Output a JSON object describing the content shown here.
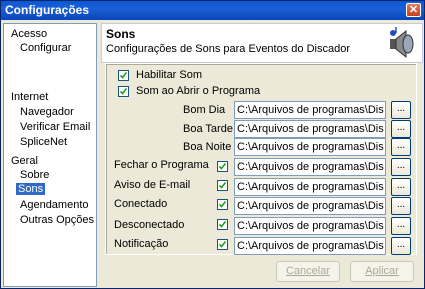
{
  "window": {
    "title": "Configurações",
    "close_label": "✕"
  },
  "sidebar": {
    "groups": [
      {
        "label": "Acesso",
        "items": [
          "Configurar"
        ]
      },
      {
        "label": "Internet",
        "items": [
          "Navegador",
          "Verificar Email",
          "SpliceNet"
        ]
      },
      {
        "label": "Geral",
        "items": [
          "Sobre",
          "Sons",
          "Agendamento",
          "Outras Opções"
        ]
      }
    ],
    "selected": "Sons"
  },
  "header": {
    "title": "Sons",
    "subtitle": "Configurações de Sons para Eventos do Discador",
    "icon": "speaker-music-icon"
  },
  "options": {
    "enable_sound": {
      "label": "Habilitar Som",
      "checked": true
    },
    "on_open": {
      "label": "Som ao Abrir o Programa",
      "checked": true
    }
  },
  "rows": [
    {
      "label": "Bom Dia",
      "path": "C:\\Arquivos de programas\\Dis",
      "browse": "..."
    },
    {
      "label": "Boa Tarde",
      "path": "C:\\Arquivos de programas\\Dis",
      "browse": "..."
    },
    {
      "label": "Boa Noite",
      "path": "C:\\Arquivos de programas\\Dis",
      "browse": "..."
    },
    {
      "label": "Fechar o Programa",
      "path": "C:\\Arquivos de programas\\Dis",
      "browse": "...",
      "checked": true
    },
    {
      "label": "Aviso de E-mail",
      "path": "C:\\Arquivos de programas\\Dis",
      "browse": "...",
      "checked": true
    },
    {
      "label": "Conectado",
      "path": "C:\\Arquivos de programas\\Dis",
      "browse": "...",
      "checked": true
    },
    {
      "label": "Desconectado",
      "path": "C:\\Arquivos de programas\\Dis",
      "browse": "...",
      "checked": true
    },
    {
      "label": "Notificação",
      "path": "C:\\Arquivos de programas\\Dis",
      "browse": "...",
      "checked": true
    }
  ],
  "buttons": {
    "cancel": "Cancelar",
    "apply": "Aplicar"
  },
  "colors": {
    "title_bar": "#0a58d0",
    "selection": "#316ac5",
    "panel": "#ece9d8"
  }
}
